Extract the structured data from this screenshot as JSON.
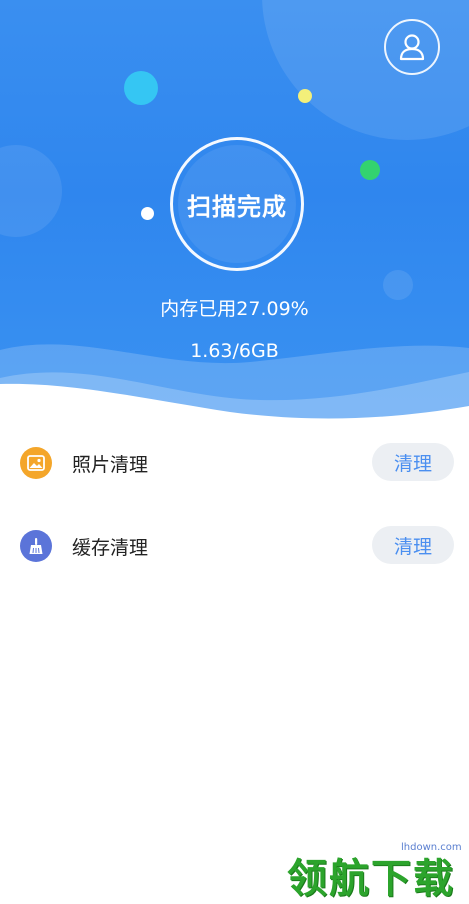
{
  "header": {
    "avatar_icon": "user-icon",
    "scan_status": "扫描完成",
    "memory_used_text": "内存已用27.09%",
    "memory_used_percent": 27.09,
    "memory_amount_text": "1.63/6GB"
  },
  "cleanup_items": [
    {
      "label": "照片清理",
      "icon": "photo-icon",
      "icon_color": "#f4a62a",
      "button_label": "清理"
    },
    {
      "label": "缓存清理",
      "icon": "broom-icon",
      "icon_color": "#5b74d9",
      "button_label": "清理"
    }
  ],
  "watermark": {
    "main_text": "领航下载",
    "url_text": "lhdown.com"
  },
  "colors": {
    "hero_blue": "#3a8ff0",
    "accent_blue": "#4b8ff0",
    "button_bg": "#eceff3"
  }
}
